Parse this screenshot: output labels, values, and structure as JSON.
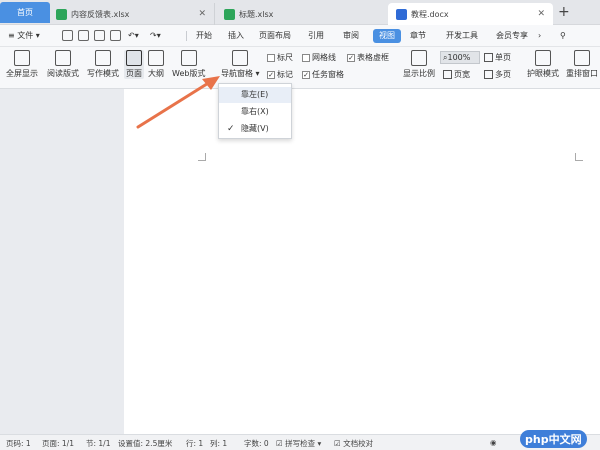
{
  "tabs": {
    "home": "首页",
    "t1": "内容反馈表.xlsx",
    "t2": "标题.xlsx",
    "t3": "教程.docx",
    "new": "+"
  },
  "menu": {
    "file": "文件",
    "items": [
      "开始",
      "插入",
      "页面布局",
      "引用",
      "审阅",
      "视图",
      "章节",
      "开发工具",
      "会员专享"
    ],
    "active": "视图"
  },
  "ribbon": {
    "fullscreen": "全屏显示",
    "reading": "阅读版式",
    "writing": "写作模式",
    "page": "页面",
    "outline": "大纲",
    "web": "Web版式",
    "nav": "导航窗格",
    "ruler": "标尺",
    "gridlines": "网格线",
    "table_borders": "表格虚框",
    "marks": "标记",
    "task_pane": "任务窗格",
    "display_ratio": "显示比例",
    "zoom": "100%",
    "single_page": "单页",
    "page_width": "页宽",
    "multi_page": "多页",
    "eye_mode": "护眼模式",
    "rearrange": "重排窗口"
  },
  "dropdown": {
    "items": [
      "靠左(E)",
      "靠右(X)",
      "隐藏(V)"
    ],
    "checked": "隐藏(V)"
  },
  "status": {
    "page_no": "页码: 1",
    "pages": "页面: 1/1",
    "section": "节: 1/1",
    "setting": "设置值: 2.5厘米",
    "row": "行: 1",
    "col": "列: 1",
    "words": "字数: 0",
    "spell": "拼写检查",
    "proof": "文档校对"
  },
  "watermark": "php中文网",
  "colors": {
    "accent": "#4a90e2",
    "arrow": "#e8734a"
  }
}
